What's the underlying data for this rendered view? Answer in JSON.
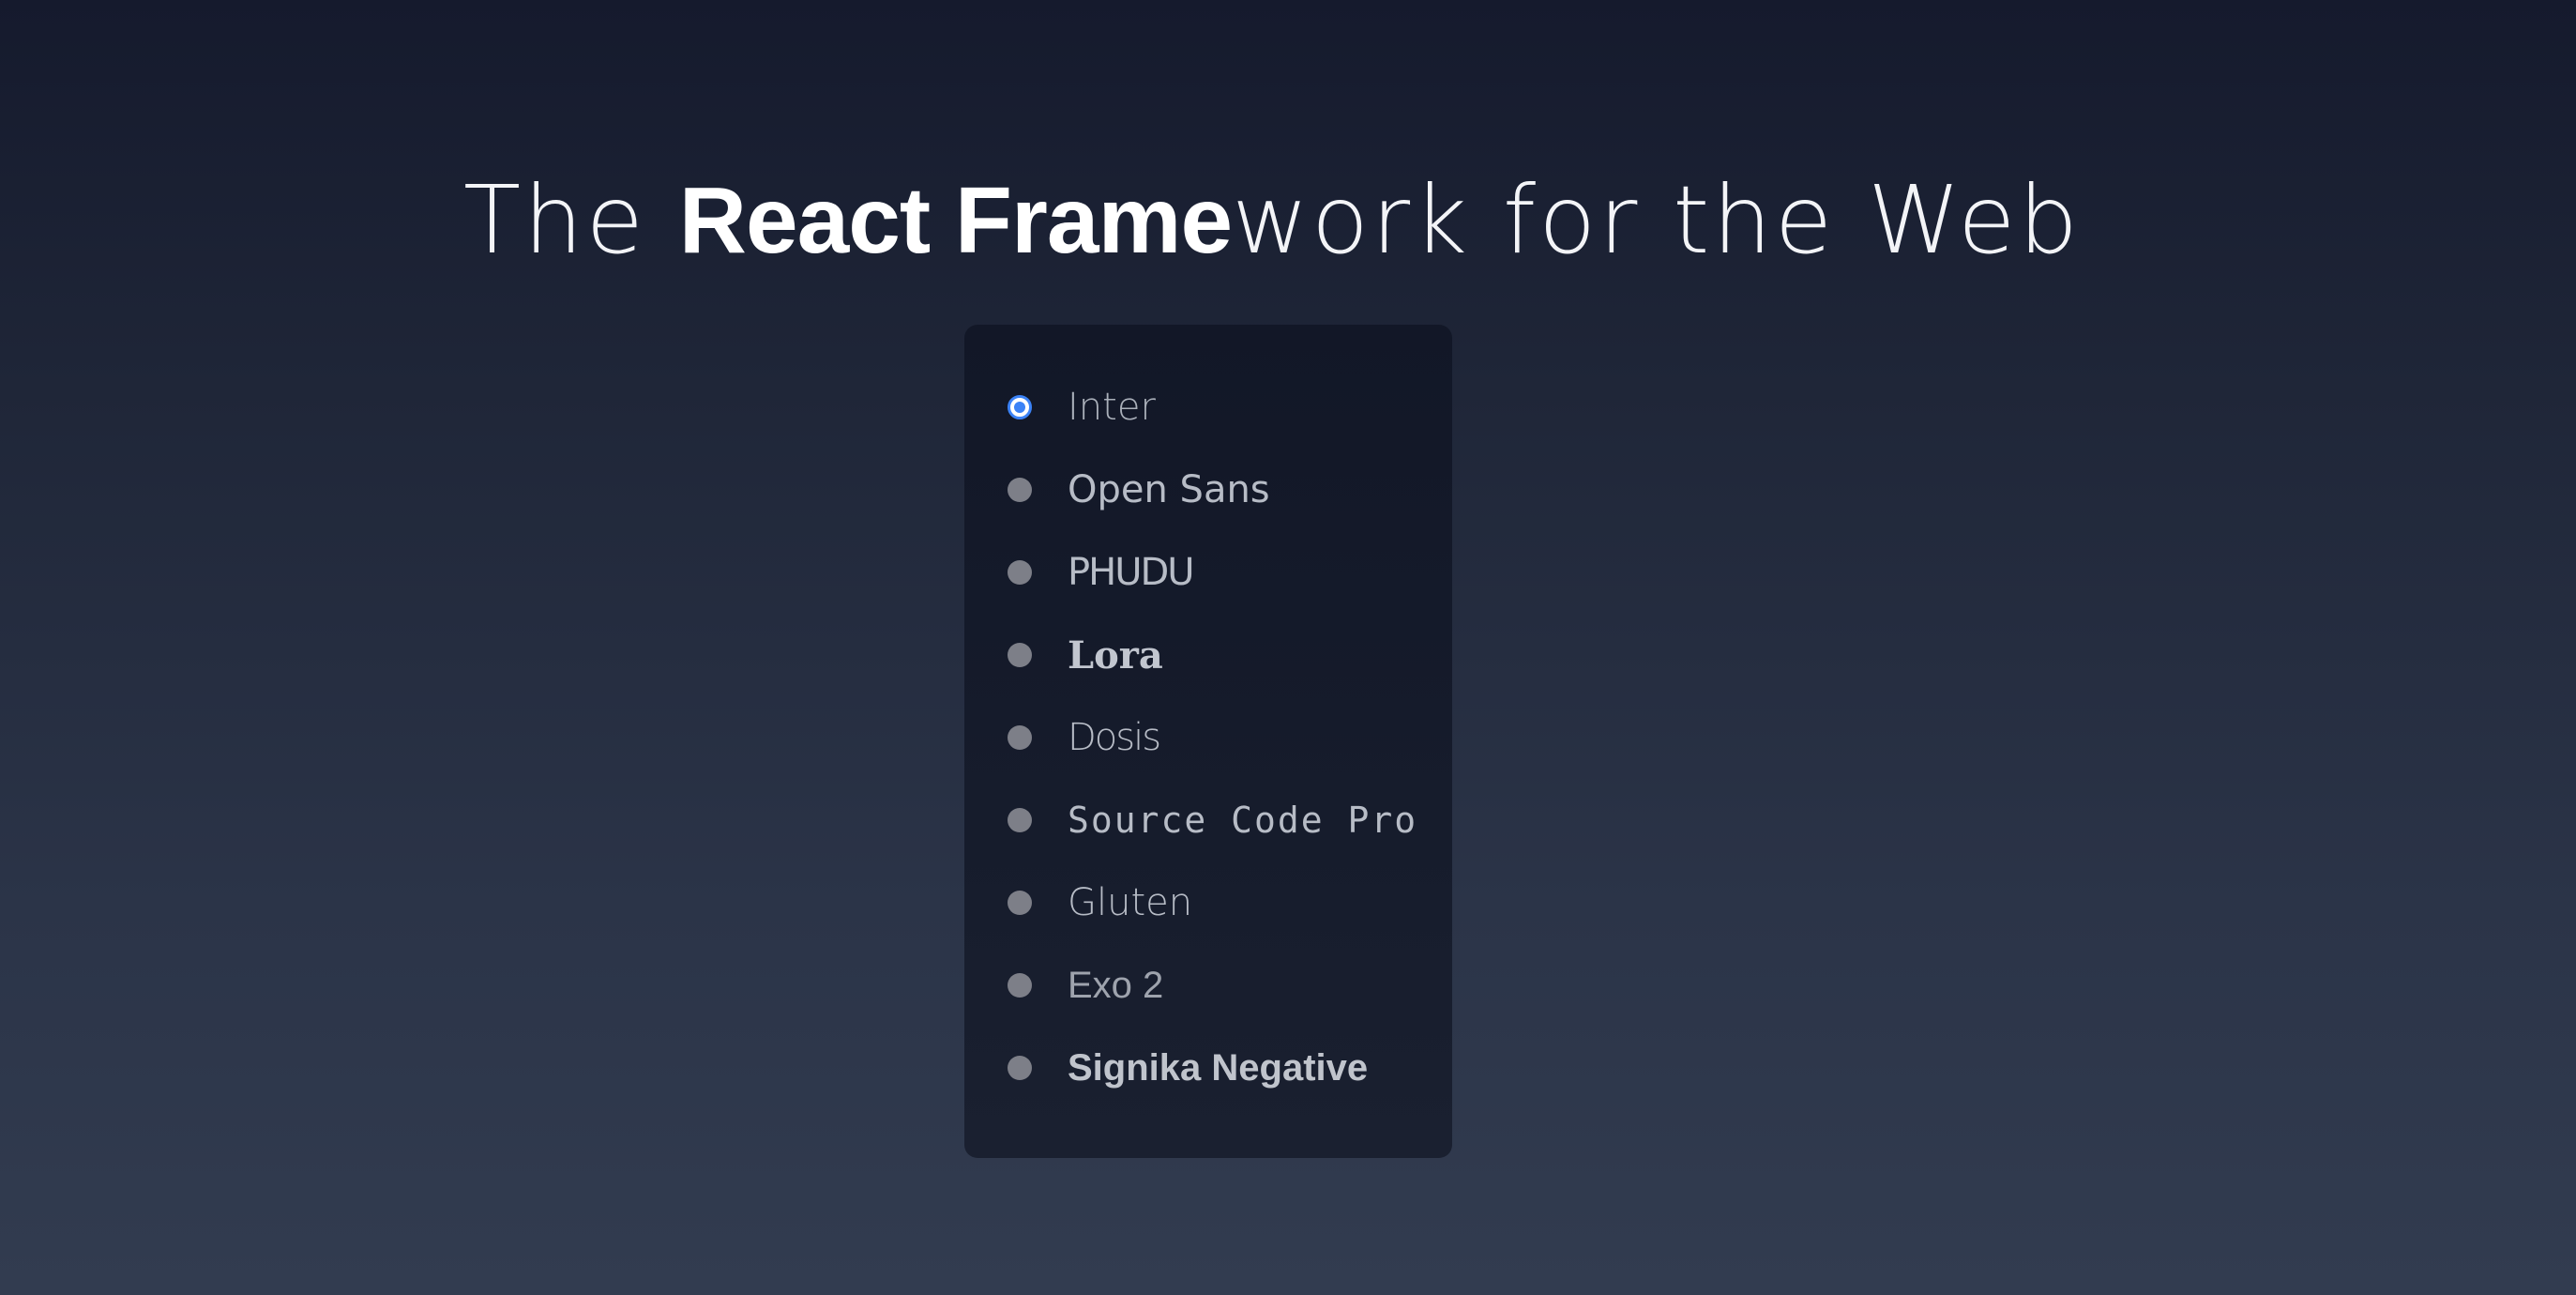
{
  "headline": {
    "part1": "The ",
    "part2": "React Frame",
    "part3": "work for the Web"
  },
  "font_options": {
    "selected": "Inter",
    "items": [
      {
        "label": "Inter",
        "checked": true
      },
      {
        "label": "Open Sans",
        "checked": false
      },
      {
        "label": "PHUDU",
        "checked": false
      },
      {
        "label": "Lora",
        "checked": false
      },
      {
        "label": "Dosis",
        "checked": false
      },
      {
        "label": "Source Code Pro",
        "checked": false
      },
      {
        "label": "Gluten",
        "checked": false
      },
      {
        "label": "Exo 2",
        "checked": false
      },
      {
        "label": "Signika Negative",
        "checked": false
      }
    ]
  },
  "colors": {
    "accent": "#3b82f6",
    "radio_unchecked": "#7d7f88",
    "panel_bg": "#141a2a"
  }
}
